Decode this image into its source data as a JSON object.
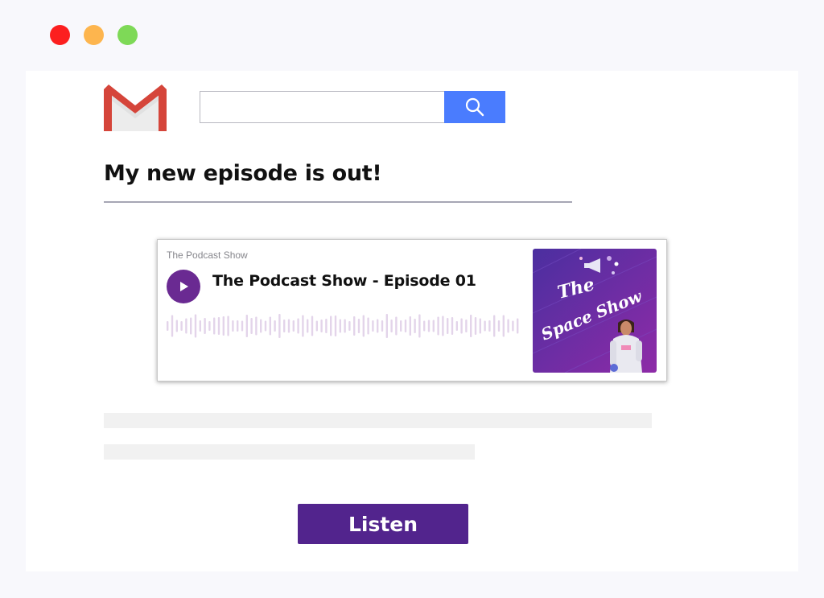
{
  "window_controls": {
    "close_color": "#fc1f1f",
    "minimize_color": "#fdb54e",
    "maximize_color": "#7ed957"
  },
  "header": {
    "logo": "gmail-logo",
    "search": {
      "value": "",
      "placeholder": "",
      "button_icon": "magnifier-icon",
      "button_color": "#4a7cfe"
    }
  },
  "email": {
    "subject": "My new episode is out!"
  },
  "player": {
    "show_name": "The Podcast Show",
    "episode_title": "The Podcast Show - Episode 01",
    "play_icon": "play-icon",
    "accent_color": "#6a2a92",
    "cover": {
      "line1": "The",
      "line2": "Space Show",
      "bg_color_start": "#4b2fa0",
      "bg_color_end": "#8e2ba7"
    }
  },
  "listen_button": {
    "label": "Listen",
    "color": "#52248d"
  }
}
